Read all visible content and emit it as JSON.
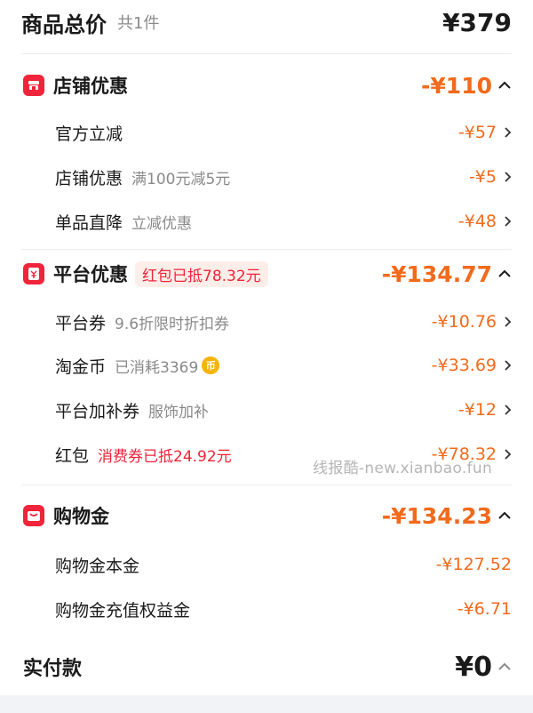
{
  "summary": {
    "title": "商品总价",
    "count": "共1件",
    "price": "¥379"
  },
  "store_discount": {
    "title": "店铺优惠",
    "amount": "-¥110",
    "items": [
      {
        "label": "官方立减",
        "note": "",
        "amount": "-¥57"
      },
      {
        "label": "店铺优惠",
        "note": "满100元减5元",
        "amount": "-¥5"
      },
      {
        "label": "单品直降",
        "note": "立减优惠",
        "amount": "-¥48"
      }
    ]
  },
  "platform_discount": {
    "title": "平台优惠",
    "badge": "红包已抵78.32元",
    "amount": "-¥134.77",
    "items": [
      {
        "label": "平台券",
        "note": "9.6折限时折扣券",
        "amount": "-¥10.76"
      },
      {
        "label": "淘金币",
        "note": "已消耗3369",
        "coin": "币",
        "amount": "-¥33.69"
      },
      {
        "label": "平台加补券",
        "note": "服饰加补",
        "amount": "-¥12"
      },
      {
        "label": "红包",
        "note": "消费券已抵24.92元",
        "amount": "-¥78.32"
      }
    ]
  },
  "shopping_money": {
    "title": "购物金",
    "amount": "-¥134.23",
    "items": [
      {
        "label": "购物金本金",
        "amount": "-¥127.52"
      },
      {
        "label": "购物金充值权益金",
        "amount": "-¥6.71"
      }
    ]
  },
  "final": {
    "label": "实付款",
    "price": "¥0"
  },
  "watermark": "线报酷-new.xianbao.fun",
  "colors": {
    "accent_orange": "#f26a1b",
    "accent_red": "#f0243a",
    "text_gray": "#8a8a8a"
  },
  "icons": [
    "store-icon",
    "platform-icon",
    "wallet-icon",
    "chevron-up-icon",
    "chevron-right-icon",
    "coin-icon"
  ]
}
